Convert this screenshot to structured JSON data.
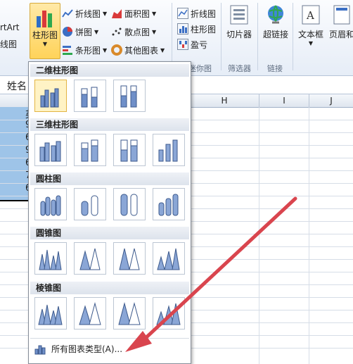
{
  "ribbon": {
    "left_cut_1": "rtArt",
    "left_cut_2": "线图",
    "chart_buttons": {
      "column": "柱形图",
      "line": "折线图",
      "pie": "饼图",
      "bar": "条形图",
      "area": "面积图",
      "scatter": "散点图",
      "other": "其他图表"
    },
    "sparklines": {
      "line": "折线图",
      "column": "柱形图",
      "winloss": "盈亏",
      "group": "迷你图"
    },
    "slicer": {
      "label": "切片器",
      "group": "筛选器"
    },
    "hyperlink": {
      "label": "超链接",
      "group": "链接"
    },
    "textbox": {
      "label": "文本框"
    },
    "header_footer": {
      "label": "页眉和"
    }
  },
  "sheet": {
    "name_cell": "姓名",
    "columns": [
      "H",
      "I",
      "J"
    ],
    "cut_cells": [
      "英",
      "9",
      "6",
      "9",
      "6",
      "7",
      "6"
    ]
  },
  "dropdown": {
    "sections": [
      {
        "title": "二维柱形图"
      },
      {
        "title": "三维柱形图"
      },
      {
        "title": "圆柱图"
      },
      {
        "title": "圆锥图"
      },
      {
        "title": "棱锥图"
      }
    ],
    "footer_label": "所有图表类型(A)..."
  },
  "colors": {
    "accent": "#4472c4",
    "selection": "#9ec4e8",
    "highlight": "#fff3c5",
    "arrow": "#d9454e"
  }
}
